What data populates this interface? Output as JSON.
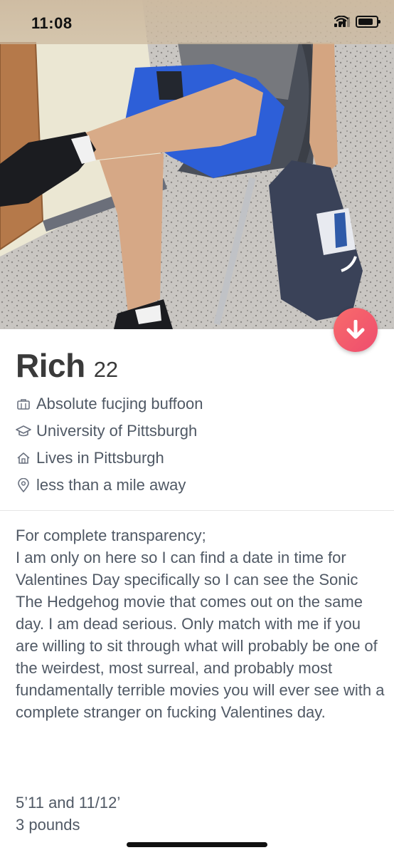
{
  "status_bar": {
    "time": "11:08",
    "icons": [
      "cellular-signal-icon",
      "wifi-icon",
      "battery-icon"
    ]
  },
  "profile": {
    "name": "Rich",
    "age": "22",
    "job": "Absolute fucjing buffoon",
    "school": "University of Pittsburgh",
    "lives": "Lives in Pittsburgh",
    "distance": "less than a mile away",
    "bio": "For complete transparency;\nI am only on here so I can find a date in time for Valentines Day specifically so I can see the Sonic The Hedgehog movie that comes out on the same day. I am dead serious. Only match with me if you are willing to sit through what will probably be one of the weirdest, most surreal, and probably most fundamentally terrible movies you will ever see with a complete stranger on fucking Valentines day.",
    "extra": "5’11 and 11/12’\n3 pounds"
  },
  "icons": {
    "job": "briefcase-icon",
    "school": "graduation-cap-icon",
    "lives": "house-icon",
    "distance": "location-pin-icon",
    "collapse": "arrow-down-icon"
  },
  "colors": {
    "accent": "#ef5270",
    "name_text": "#3a3a3a",
    "body_text": "#505965"
  }
}
